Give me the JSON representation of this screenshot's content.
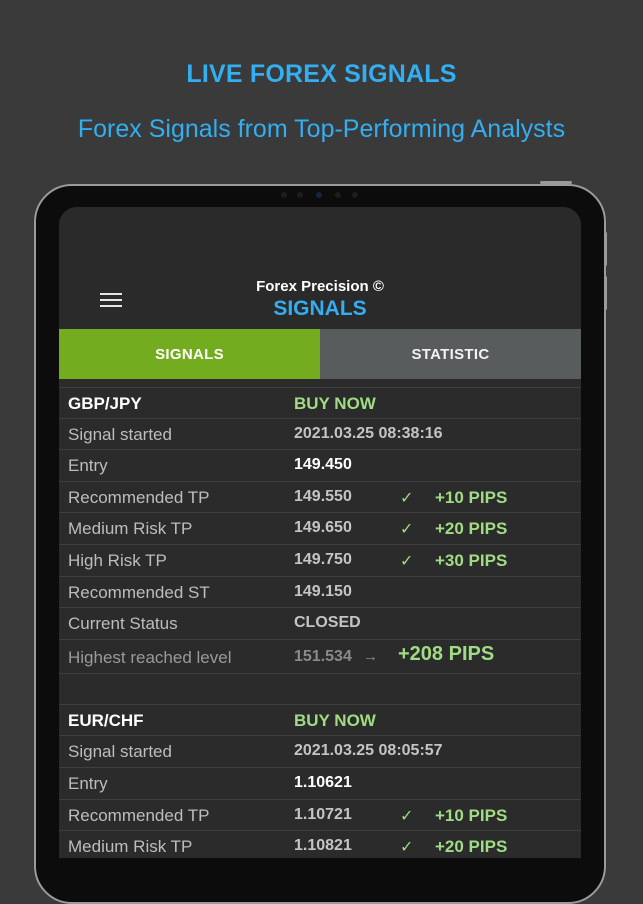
{
  "promo": {
    "headline": "LIVE FOREX SIGNALS",
    "subhead": "Forex Signals from Top-Performing Analysts"
  },
  "app": {
    "name": "Forex Precision ©",
    "section_title": "SIGNALS"
  },
  "tabs": [
    {
      "label": "SIGNALS",
      "active": true
    },
    {
      "label": "STATISTIC",
      "active": false
    }
  ],
  "colors": {
    "accent_blue": "#33aef0",
    "tab_active": "#73ad1f",
    "tab_inactive": "#585c5d",
    "pips_green": "#9fdc84"
  },
  "icons": {
    "menu": "hamburger-menu-icon",
    "check": "✓",
    "arrow": "→"
  },
  "signals": [
    {
      "pair": "GBP/JPY",
      "action": "BUY NOW",
      "rows": {
        "signal_started": {
          "label": "Signal started",
          "value": "2021.03.25 08:38:16"
        },
        "entry": {
          "label": "Entry",
          "value": "149.450"
        },
        "recommended_tp": {
          "label": "Recommended TP",
          "value": "149.550",
          "pips": "+10 PIPS"
        },
        "medium_risk_tp": {
          "label": "Medium Risk TP",
          "value": "149.650",
          "pips": "+20 PIPS"
        },
        "high_risk_tp": {
          "label": "High Risk TP",
          "value": "149.750",
          "pips": "+30 PIPS"
        },
        "recommended_st": {
          "label": "Recommended ST",
          "value": "149.150"
        },
        "current_status": {
          "label": "Current Status",
          "value": "CLOSED"
        },
        "highest_level": {
          "label": "Highest reached level",
          "value": "151.534",
          "pips": "+208 PIPS"
        }
      }
    },
    {
      "pair": "EUR/CHF",
      "action": "BUY NOW",
      "rows": {
        "signal_started": {
          "label": "Signal started",
          "value": "2021.03.25 08:05:57"
        },
        "entry": {
          "label": "Entry",
          "value": "1.10621"
        },
        "recommended_tp": {
          "label": "Recommended TP",
          "value": "1.10721",
          "pips": "+10 PIPS"
        },
        "medium_risk_tp": {
          "label": "Medium Risk TP",
          "value": "1.10821",
          "pips": "+20 PIPS"
        }
      }
    }
  ]
}
